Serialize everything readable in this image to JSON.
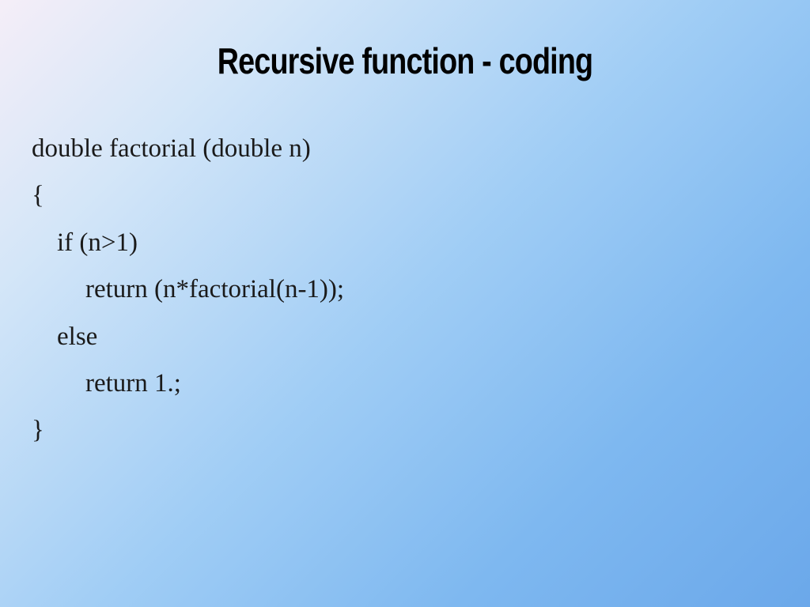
{
  "slide": {
    "title": "Recursive function - coding",
    "code": {
      "line1": "double factorial (double n)",
      "line2": "{",
      "line3": "if (n>1)",
      "line4": "return (n*factorial(n-1));",
      "line5": "else",
      "line6": "return 1.;",
      "line7": "}"
    }
  }
}
